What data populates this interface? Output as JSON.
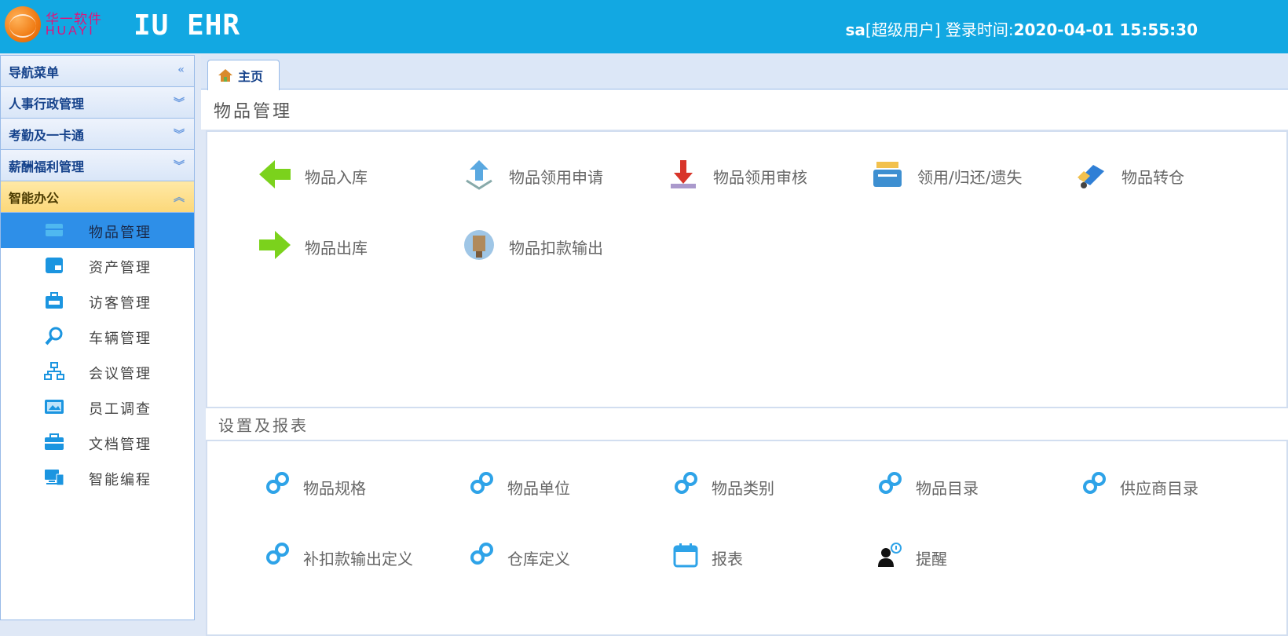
{
  "header": {
    "logo_cn": "华一软件",
    "logo_en": "HUAYI",
    "app_title": "IU EHR",
    "user": "sa",
    "role": "[超级用户]",
    "login_label": "登录时间:",
    "login_time": "2020-04-01 15:55:30"
  },
  "sidebar": {
    "nav_header": "导航菜单",
    "sections": [
      {
        "label": "人事行政管理"
      },
      {
        "label": "考勤及一卡通"
      },
      {
        "label": "薪酬福利管理"
      },
      {
        "label": "智能办公"
      }
    ],
    "items": [
      {
        "label": "物品管理",
        "icon": "goods-icon"
      },
      {
        "label": "资产管理",
        "icon": "asset-icon"
      },
      {
        "label": "访客管理",
        "icon": "visitor-icon"
      },
      {
        "label": "车辆管理",
        "icon": "vehicle-icon"
      },
      {
        "label": "会议管理",
        "icon": "meeting-icon"
      },
      {
        "label": "员工调查",
        "icon": "survey-icon"
      },
      {
        "label": "文档管理",
        "icon": "document-icon"
      },
      {
        "label": "智能编程",
        "icon": "programming-icon"
      }
    ]
  },
  "tabs": [
    {
      "label": "主页"
    }
  ],
  "goods_panel": {
    "title": "物品管理",
    "items": [
      {
        "label": "物品入库"
      },
      {
        "label": "物品领用申请"
      },
      {
        "label": "物品领用审核"
      },
      {
        "label": "领用/归还/遗失"
      },
      {
        "label": "物品转仓"
      },
      {
        "label": "物品出库"
      },
      {
        "label": "物品扣款输出"
      }
    ]
  },
  "settings_panel": {
    "title": "设置及报表",
    "items": [
      {
        "label": "物品规格"
      },
      {
        "label": "物品单位"
      },
      {
        "label": "物品类别"
      },
      {
        "label": "物品目录"
      },
      {
        "label": "供应商目录"
      },
      {
        "label": "补扣款输出定义"
      },
      {
        "label": "仓库定义"
      },
      {
        "label": "报表"
      },
      {
        "label": "提醒"
      }
    ]
  },
  "colors": {
    "header_bg": "#12a8e2",
    "selected_item": "#2e8fe8",
    "active_section": "#fcd87a"
  }
}
